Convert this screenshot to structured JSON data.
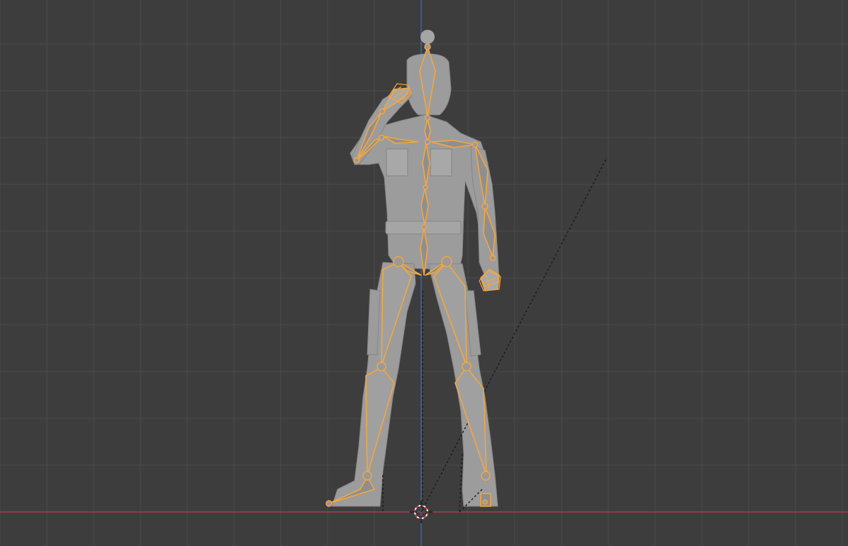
{
  "viewport": {
    "view": "front-orthographic",
    "mode": "pose",
    "background_color": "#3d3d3d",
    "grid_color": "#4a4a4a",
    "x_axis_color": "#b8434e",
    "z_axis_color": "#3c6fb6",
    "armature_color": "#f5a640",
    "mesh_color": "#9a9a9a",
    "objects": [
      {
        "name": "character-mesh",
        "type": "mesh"
      },
      {
        "name": "armature",
        "type": "armature",
        "selected": true
      }
    ],
    "cursor_icon": "3d-cursor-icon"
  }
}
